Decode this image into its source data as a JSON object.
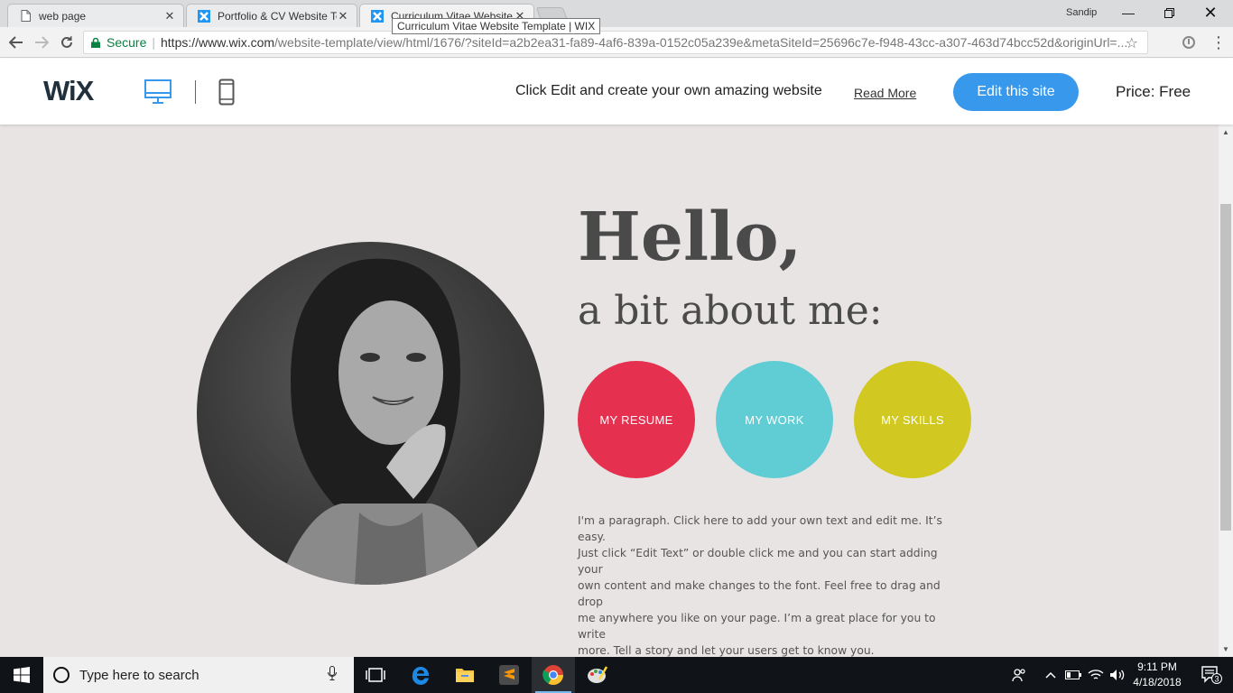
{
  "browser": {
    "tabs": [
      {
        "title": "web page",
        "favicon": "document-icon"
      },
      {
        "title": "Portfolio & CV Website Te",
        "favicon": "wix-icon"
      },
      {
        "title": "Curriculum Vitae Website",
        "favicon": "wix-icon"
      }
    ],
    "active_tab_index": 2,
    "tooltip": "Curriculum Vitae Website Template | WIX",
    "profile_name": "Sandip",
    "secure_label": "Secure",
    "url_main": "https://www.wix.com",
    "url_rest": "/website-template/view/html/1676/?siteId=a2b2ea31-fa89-4af6-839a-0152c05a239e&metaSiteId=25696c7e-f948-43cc-a307-463d74bcc52d&originUrl=..."
  },
  "wix_header": {
    "logo": "WiX",
    "promo_text": "Click Edit and create your own amazing website",
    "read_more": "Read More",
    "edit_button": "Edit this site",
    "price": "Price: Free"
  },
  "page": {
    "heading": "Hello,",
    "subheading": "a bit about me:",
    "buttons": [
      {
        "label": "MY RESUME",
        "color": "#e5304f"
      },
      {
        "label": "MY WORK",
        "color": "#5fcdd3"
      },
      {
        "label": "MY SKILLS",
        "color": "#d1c821"
      }
    ],
    "paragraph_lines": [
      "I'm a paragraph. Click here to add your own text and edit me. It’s easy.",
      "Just click “Edit Text” or double click me and you can start adding your",
      "own content and make changes to the font. Feel free to drag and drop",
      "me anywhere you like on your page. I’m a great place for you to write",
      "more. Tell a story and let your users get to know you."
    ]
  },
  "taskbar": {
    "search_placeholder": "Type here to search",
    "time": "9:11 PM",
    "date": "4/18/2018",
    "notification_count": "3"
  }
}
